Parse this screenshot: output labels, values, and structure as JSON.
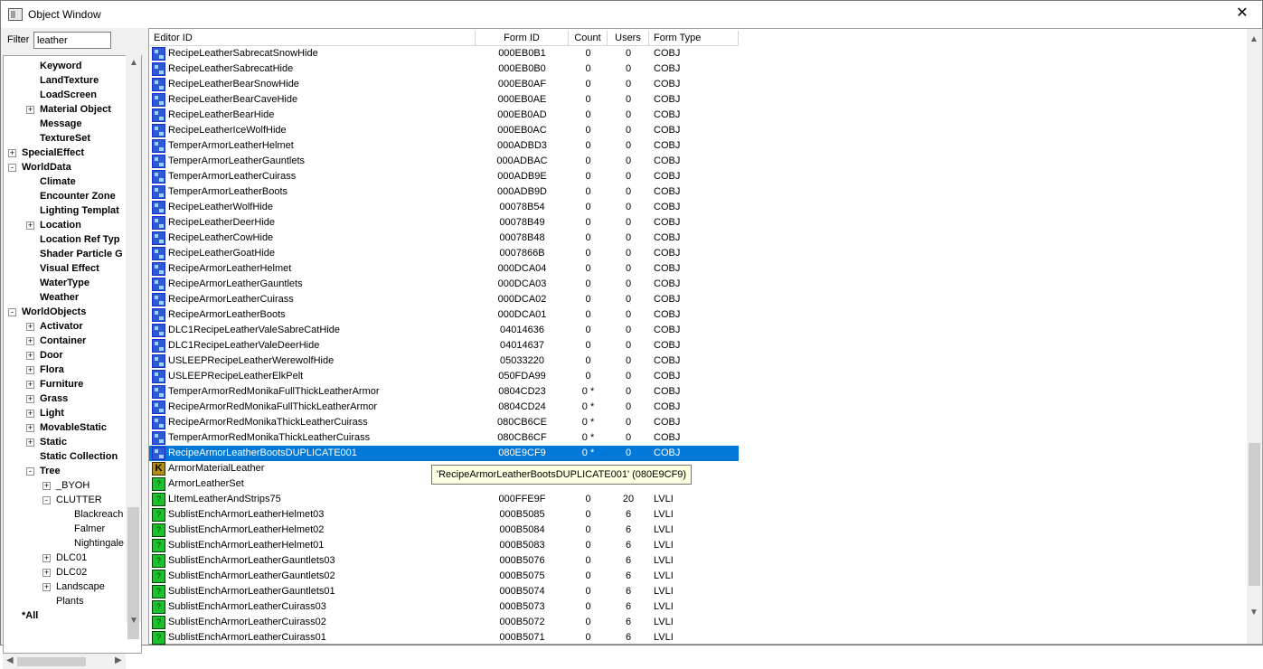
{
  "window": {
    "title": "Object Window",
    "close_glyph": "✕"
  },
  "filter": {
    "label": "Filter",
    "value": "leather"
  },
  "tree": [
    {
      "label": "Keyword",
      "indent": 2,
      "expander": ""
    },
    {
      "label": "LandTexture",
      "indent": 2,
      "expander": ""
    },
    {
      "label": "LoadScreen",
      "indent": 2,
      "expander": ""
    },
    {
      "label": "Material Object",
      "indent": 2,
      "expander": "+"
    },
    {
      "label": "Message",
      "indent": 2,
      "expander": ""
    },
    {
      "label": "TextureSet",
      "indent": 2,
      "expander": ""
    },
    {
      "label": "SpecialEffect",
      "indent": 1,
      "expander": "+"
    },
    {
      "label": "WorldData",
      "indent": 1,
      "expander": "-"
    },
    {
      "label": "Climate",
      "indent": 2,
      "expander": ""
    },
    {
      "label": "Encounter Zone",
      "indent": 2,
      "expander": ""
    },
    {
      "label": "Lighting Templat",
      "indent": 2,
      "expander": ""
    },
    {
      "label": "Location",
      "indent": 2,
      "expander": "+"
    },
    {
      "label": "Location Ref Typ",
      "indent": 2,
      "expander": ""
    },
    {
      "label": "Shader Particle G",
      "indent": 2,
      "expander": ""
    },
    {
      "label": "Visual Effect",
      "indent": 2,
      "expander": ""
    },
    {
      "label": "WaterType",
      "indent": 2,
      "expander": ""
    },
    {
      "label": "Weather",
      "indent": 2,
      "expander": ""
    },
    {
      "label": "WorldObjects",
      "indent": 1,
      "expander": "-"
    },
    {
      "label": "Activator",
      "indent": 2,
      "expander": "+"
    },
    {
      "label": "Container",
      "indent": 2,
      "expander": "+"
    },
    {
      "label": "Door",
      "indent": 2,
      "expander": "+"
    },
    {
      "label": "Flora",
      "indent": 2,
      "expander": "+"
    },
    {
      "label": "Furniture",
      "indent": 2,
      "expander": "+"
    },
    {
      "label": "Grass",
      "indent": 2,
      "expander": "+"
    },
    {
      "label": "Light",
      "indent": 2,
      "expander": "+"
    },
    {
      "label": "MovableStatic",
      "indent": 2,
      "expander": "+"
    },
    {
      "label": "Static",
      "indent": 2,
      "expander": "+"
    },
    {
      "label": "Static Collection",
      "indent": 2,
      "expander": ""
    },
    {
      "label": "Tree",
      "indent": 2,
      "expander": "-"
    },
    {
      "label": "_BYOH",
      "indent": 3,
      "expander": "+",
      "light": true
    },
    {
      "label": "CLUTTER",
      "indent": 3,
      "expander": "-",
      "light": true
    },
    {
      "label": "Blackreach",
      "indent": 4,
      "expander": "",
      "light": true
    },
    {
      "label": "Falmer",
      "indent": 4,
      "expander": "",
      "light": true
    },
    {
      "label": "Nightingale",
      "indent": 4,
      "expander": "",
      "light": true
    },
    {
      "label": "DLC01",
      "indent": 3,
      "expander": "+",
      "light": true
    },
    {
      "label": "DLC02",
      "indent": 3,
      "expander": "+",
      "light": true
    },
    {
      "label": "Landscape",
      "indent": 3,
      "expander": "+",
      "light": true
    },
    {
      "label": "Plants",
      "indent": 3,
      "expander": "",
      "light": true
    },
    {
      "label": "*All",
      "indent": 1,
      "expander": ""
    }
  ],
  "columns": [
    "Editor ID",
    "Form ID",
    "Count",
    "Users",
    "Form Type"
  ],
  "rows": [
    {
      "icon": "cobj",
      "editor_id": "RecipeLeatherSabrecatSnowHide",
      "form_id": "000EB0B1",
      "count": "0",
      "users": "0",
      "type": "COBJ"
    },
    {
      "icon": "cobj",
      "editor_id": "RecipeLeatherSabrecatHide",
      "form_id": "000EB0B0",
      "count": "0",
      "users": "0",
      "type": "COBJ"
    },
    {
      "icon": "cobj",
      "editor_id": "RecipeLeatherBearSnowHide",
      "form_id": "000EB0AF",
      "count": "0",
      "users": "0",
      "type": "COBJ"
    },
    {
      "icon": "cobj",
      "editor_id": "RecipeLeatherBearCaveHide",
      "form_id": "000EB0AE",
      "count": "0",
      "users": "0",
      "type": "COBJ"
    },
    {
      "icon": "cobj",
      "editor_id": "RecipeLeatherBearHide",
      "form_id": "000EB0AD",
      "count": "0",
      "users": "0",
      "type": "COBJ"
    },
    {
      "icon": "cobj",
      "editor_id": "RecipeLeatherIceWolfHide",
      "form_id": "000EB0AC",
      "count": "0",
      "users": "0",
      "type": "COBJ"
    },
    {
      "icon": "cobj",
      "editor_id": "TemperArmorLeatherHelmet",
      "form_id": "000ADBD3",
      "count": "0",
      "users": "0",
      "type": "COBJ"
    },
    {
      "icon": "cobj",
      "editor_id": "TemperArmorLeatherGauntlets",
      "form_id": "000ADBAC",
      "count": "0",
      "users": "0",
      "type": "COBJ"
    },
    {
      "icon": "cobj",
      "editor_id": "TemperArmorLeatherCuirass",
      "form_id": "000ADB9E",
      "count": "0",
      "users": "0",
      "type": "COBJ"
    },
    {
      "icon": "cobj",
      "editor_id": "TemperArmorLeatherBoots",
      "form_id": "000ADB9D",
      "count": "0",
      "users": "0",
      "type": "COBJ"
    },
    {
      "icon": "cobj",
      "editor_id": "RecipeLeatherWolfHide",
      "form_id": "00078B54",
      "count": "0",
      "users": "0",
      "type": "COBJ"
    },
    {
      "icon": "cobj",
      "editor_id": "RecipeLeatherDeerHide",
      "form_id": "00078B49",
      "count": "0",
      "users": "0",
      "type": "COBJ"
    },
    {
      "icon": "cobj",
      "editor_id": "RecipeLeatherCowHide",
      "form_id": "00078B48",
      "count": "0",
      "users": "0",
      "type": "COBJ"
    },
    {
      "icon": "cobj",
      "editor_id": "RecipeLeatherGoatHide",
      "form_id": "0007866B",
      "count": "0",
      "users": "0",
      "type": "COBJ"
    },
    {
      "icon": "cobj",
      "editor_id": "RecipeArmorLeatherHelmet",
      "form_id": "000DCA04",
      "count": "0",
      "users": "0",
      "type": "COBJ"
    },
    {
      "icon": "cobj",
      "editor_id": "RecipeArmorLeatherGauntlets",
      "form_id": "000DCA03",
      "count": "0",
      "users": "0",
      "type": "COBJ"
    },
    {
      "icon": "cobj",
      "editor_id": "RecipeArmorLeatherCuirass",
      "form_id": "000DCA02",
      "count": "0",
      "users": "0",
      "type": "COBJ"
    },
    {
      "icon": "cobj",
      "editor_id": "RecipeArmorLeatherBoots",
      "form_id": "000DCA01",
      "count": "0",
      "users": "0",
      "type": "COBJ"
    },
    {
      "icon": "cobj",
      "editor_id": "DLC1RecipeLeatherValeSabreCatHide",
      "form_id": "04014636",
      "count": "0",
      "users": "0",
      "type": "COBJ"
    },
    {
      "icon": "cobj",
      "editor_id": "DLC1RecipeLeatherValeDeerHide",
      "form_id": "04014637",
      "count": "0",
      "users": "0",
      "type": "COBJ"
    },
    {
      "icon": "cobj",
      "editor_id": "USLEEPRecipeLeatherWerewolfHide",
      "form_id": "05033220",
      "count": "0",
      "users": "0",
      "type": "COBJ"
    },
    {
      "icon": "cobj",
      "editor_id": "USLEEPRecipeLeatherElkPelt",
      "form_id": "050FDA99",
      "count": "0",
      "users": "0",
      "type": "COBJ"
    },
    {
      "icon": "cobj",
      "editor_id": "TemperArmorRedMonikaFullThickLeatherArmor",
      "form_id": "0804CD23",
      "count": "0 *",
      "users": "0",
      "type": "COBJ"
    },
    {
      "icon": "cobj",
      "editor_id": "RecipeArmorRedMonikaFullThickLeatherArmor",
      "form_id": "0804CD24",
      "count": "0 *",
      "users": "0",
      "type": "COBJ"
    },
    {
      "icon": "cobj",
      "editor_id": "RecipeArmorRedMonikaThickLeatherCuirass",
      "form_id": "080CB6CE",
      "count": "0 *",
      "users": "0",
      "type": "COBJ"
    },
    {
      "icon": "cobj",
      "editor_id": "TemperArmorRedMonikaThickLeatherCuirass",
      "form_id": "080CB6CF",
      "count": "0 *",
      "users": "0",
      "type": "COBJ"
    },
    {
      "icon": "cobj",
      "editor_id": "RecipeArmorLeatherBootsDUPLICATE001",
      "form_id": "080E9CF9",
      "count": "0 *",
      "users": "0",
      "type": "COBJ",
      "selected": true
    },
    {
      "icon": "kwd",
      "icon_glyph": "K",
      "editor_id": "ArmorMaterialLeather",
      "form_id": "",
      "count": "",
      "users": "",
      "type": ""
    },
    {
      "icon": "lvli",
      "icon_glyph": "?",
      "editor_id": "ArmorLeatherSet",
      "form_id": "",
      "count": "",
      "users": "",
      "type": ""
    },
    {
      "icon": "lvli",
      "icon_glyph": "?",
      "editor_id": "LItemLeatherAndStrips75",
      "form_id": "000FFE9F",
      "count": "0",
      "users": "20",
      "type": "LVLI"
    },
    {
      "icon": "lvli",
      "icon_glyph": "?",
      "editor_id": "SublistEnchArmorLeatherHelmet03",
      "form_id": "000B5085",
      "count": "0",
      "users": "6",
      "type": "LVLI"
    },
    {
      "icon": "lvli",
      "icon_glyph": "?",
      "editor_id": "SublistEnchArmorLeatherHelmet02",
      "form_id": "000B5084",
      "count": "0",
      "users": "6",
      "type": "LVLI"
    },
    {
      "icon": "lvli",
      "icon_glyph": "?",
      "editor_id": "SublistEnchArmorLeatherHelmet01",
      "form_id": "000B5083",
      "count": "0",
      "users": "6",
      "type": "LVLI"
    },
    {
      "icon": "lvli",
      "icon_glyph": "?",
      "editor_id": "SublistEnchArmorLeatherGauntlets03",
      "form_id": "000B5076",
      "count": "0",
      "users": "6",
      "type": "LVLI"
    },
    {
      "icon": "lvli",
      "icon_glyph": "?",
      "editor_id": "SublistEnchArmorLeatherGauntlets02",
      "form_id": "000B5075",
      "count": "0",
      "users": "6",
      "type": "LVLI"
    },
    {
      "icon": "lvli",
      "icon_glyph": "?",
      "editor_id": "SublistEnchArmorLeatherGauntlets01",
      "form_id": "000B5074",
      "count": "0",
      "users": "6",
      "type": "LVLI"
    },
    {
      "icon": "lvli",
      "icon_glyph": "?",
      "editor_id": "SublistEnchArmorLeatherCuirass03",
      "form_id": "000B5073",
      "count": "0",
      "users": "6",
      "type": "LVLI"
    },
    {
      "icon": "lvli",
      "icon_glyph": "?",
      "editor_id": "SublistEnchArmorLeatherCuirass02",
      "form_id": "000B5072",
      "count": "0",
      "users": "6",
      "type": "LVLI"
    },
    {
      "icon": "lvli",
      "icon_glyph": "?",
      "editor_id": "SublistEnchArmorLeatherCuirass01",
      "form_id": "000B5071",
      "count": "0",
      "users": "6",
      "type": "LVLI"
    }
  ],
  "tooltip": "'RecipeArmorLeatherBootsDUPLICATE001' (080E9CF9)",
  "colors": {
    "selection": "#0078d7",
    "tooltip_bg": "#ffffe1",
    "cobj_icon": "#2c5bd6",
    "lvli_icon": "#1bc22b",
    "keyword_icon": "#b48c14"
  }
}
